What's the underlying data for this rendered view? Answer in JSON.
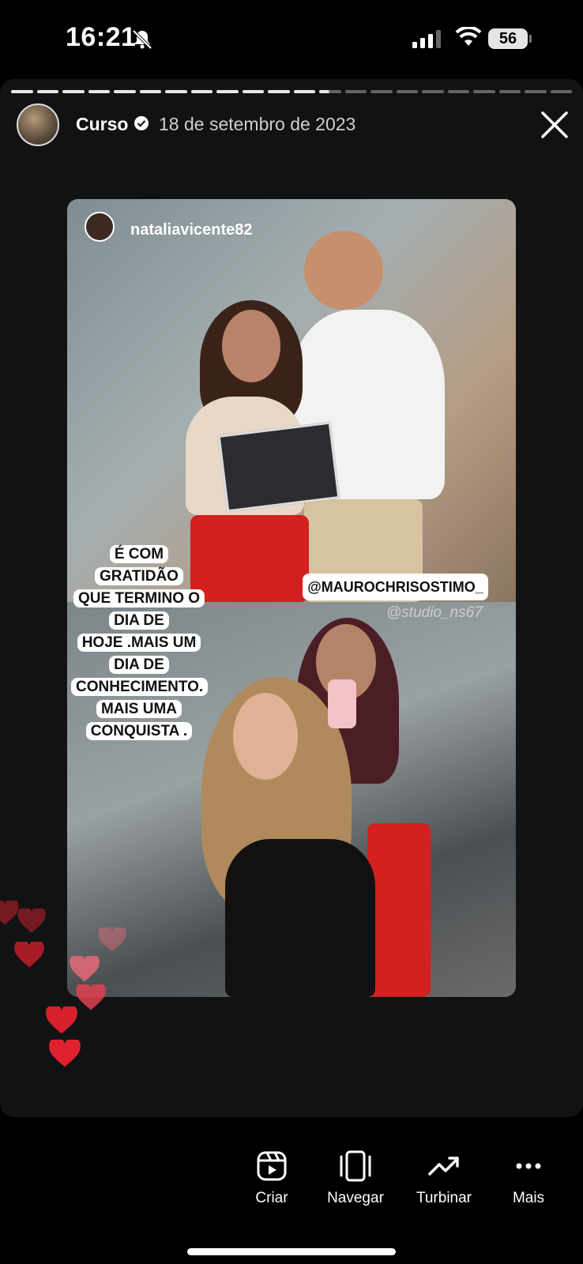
{
  "status_bar": {
    "time": "16:21",
    "battery": "56",
    "icons": [
      "bell-off-icon",
      "signal-icon",
      "wifi-icon",
      "battery-icon"
    ]
  },
  "story": {
    "progress": {
      "segments": 22,
      "current_index": 12,
      "current_fill": 0.45
    },
    "username": "Curso",
    "date": "18 de setembro de 2023",
    "verified": true,
    "content": {
      "inner_username": "nataliavicente82",
      "caption_lines": [
        "É COM GRATIDÃO",
        "QUE TERMINO O",
        "DIA DE",
        "HOJE .MAIS UM",
        "DIA DE",
        "CONHECIMENTO.",
        "MAIS UMA",
        "CONQUISTA ."
      ],
      "mention": "@MAUROCHRISOSTIMO_",
      "watermark": "@studio_ns67"
    }
  },
  "actions": [
    {
      "label": "Criar",
      "icon": "reel-icon"
    },
    {
      "label": "Navegar",
      "icon": "browse-icon"
    },
    {
      "label": "Turbinar",
      "icon": "trending-icon"
    },
    {
      "label": "Mais",
      "icon": "more-icon"
    }
  ],
  "colors": {
    "heart": "#d8202c",
    "heart_faded": "#e66a78",
    "background": "#000000",
    "story_bg": "#111214"
  }
}
